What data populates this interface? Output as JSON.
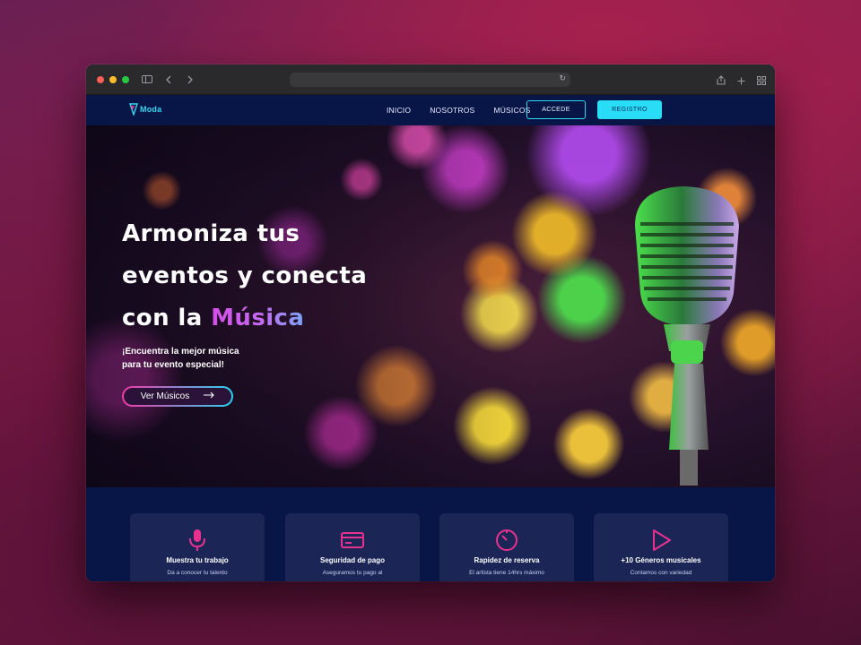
{
  "browser": {
    "url": "",
    "icons": [
      "sidebar-icon",
      "back-icon",
      "forward-icon",
      "reload-icon",
      "share-icon",
      "new-tab-icon",
      "tab-overview-icon"
    ]
  },
  "nav": {
    "logo_text": "Moda",
    "links": [
      "INICIO",
      "NOSOTROS",
      "MÚSICOS"
    ],
    "login_label": "ACCEDE",
    "register_label": "REGISTRO"
  },
  "hero": {
    "title_line1": "Armoniza tus",
    "title_line2": "eventos y conecta",
    "title_line3_prefix": "con la ",
    "title_line3_accent": "Música",
    "subtitle": "¡Encuentra la mejor música para tu evento especial!",
    "cta_label": "Ver Músicos"
  },
  "features": [
    {
      "icon": "microphone-icon",
      "title": "Muestra tu trabajo",
      "desc": "Da a conocer tu talento"
    },
    {
      "icon": "credit-card-icon",
      "title": "Seguridad de pago",
      "desc": "Aseguramos tu pago al"
    },
    {
      "icon": "timer-icon",
      "title": "Rapidez de reserva",
      "desc": "El artista tiene 14hrs máximo"
    },
    {
      "icon": "play-icon",
      "title": "+10 Géneros musicales",
      "desc": "Contamos con variedad"
    }
  ],
  "colors": {
    "accent_cyan": "#29ddf7",
    "accent_pink": "#e8318f",
    "nav_bg": "#081547",
    "card_bg": "#1b2657"
  }
}
